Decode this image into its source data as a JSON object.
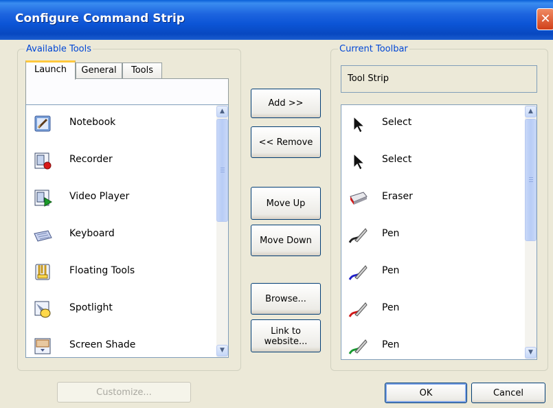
{
  "window": {
    "title": "Configure Command Strip",
    "close_glyph": "✕"
  },
  "available": {
    "group_label": "Available Tools",
    "tabs": [
      {
        "label": "Launch",
        "active": true
      },
      {
        "label": "General",
        "active": false
      },
      {
        "label": "Tools",
        "active": false
      }
    ],
    "items": [
      {
        "label": "Notebook",
        "icon": "notebook-icon"
      },
      {
        "label": "Recorder",
        "icon": "recorder-icon"
      },
      {
        "label": "Video Player",
        "icon": "video-player-icon"
      },
      {
        "label": "Keyboard",
        "icon": "keyboard-icon"
      },
      {
        "label": "Floating Tools",
        "icon": "floating-tools-icon"
      },
      {
        "label": "Spotlight",
        "icon": "spotlight-icon"
      },
      {
        "label": "Screen Shade",
        "icon": "screen-shade-icon"
      }
    ]
  },
  "middle_buttons": {
    "add": "Add >>",
    "remove": "<< Remove",
    "move_up": "Move Up",
    "move_down": "Move Down",
    "browse": "Browse...",
    "link_line1": "Link to",
    "link_line2": "website..."
  },
  "current": {
    "group_label": "Current Toolbar",
    "toolbar_name": "Tool Strip",
    "items": [
      {
        "label": "Select",
        "icon": "select-arrow-icon"
      },
      {
        "label": "Select",
        "icon": "select-arrow-icon"
      },
      {
        "label": "Eraser",
        "icon": "eraser-icon"
      },
      {
        "label": "Pen",
        "icon": "pen-black-icon",
        "color": "#222222"
      },
      {
        "label": "Pen",
        "icon": "pen-blue-icon",
        "color": "#2020c8"
      },
      {
        "label": "Pen",
        "icon": "pen-red-icon",
        "color": "#d01818"
      },
      {
        "label": "Pen",
        "icon": "pen-green-icon",
        "color": "#189a30"
      }
    ]
  },
  "footer": {
    "customize": "Customize...",
    "ok": "OK",
    "cancel": "Cancel"
  },
  "colors": {
    "title_bar": "#0c55d6",
    "dialog_bg": "#ece9d8",
    "group_label": "#0046d5",
    "active_tab_accent": "#ffc83c"
  }
}
